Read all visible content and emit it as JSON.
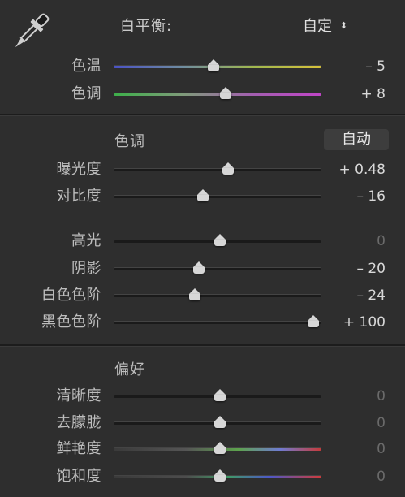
{
  "white_balance": {
    "label": "白平衡:",
    "value": "自定",
    "sliders": [
      {
        "name": "temp",
        "label": "色温",
        "value_text": "– 5",
        "position": 0.48,
        "track": "linear-gradient(90deg,#4a52c6,#6f8da0,#9fb74f,#d6c13a)",
        "dim": false
      },
      {
        "name": "tint",
        "label": "色调",
        "value_text": "+ 8",
        "position": 0.54,
        "track": "linear-gradient(90deg,#3db04a,#7f9b7a,#a35fb0,#c045c7)",
        "dim": false
      }
    ]
  },
  "tone": {
    "title": "色调",
    "auto_label": "自动",
    "sliders": [
      {
        "name": "exposure",
        "label": "曝光度",
        "value_text": "+ 0.48",
        "position": 0.55,
        "dim": false
      },
      {
        "name": "contrast",
        "label": "对比度",
        "value_text": "– 16",
        "position": 0.43,
        "dim": false
      },
      {
        "name": "highlights",
        "label": "高光",
        "value_text": "0",
        "position": 0.51,
        "dim": true
      },
      {
        "name": "shadows",
        "label": "阴影",
        "value_text": "– 20",
        "position": 0.41,
        "dim": false
      },
      {
        "name": "whites",
        "label": "白色色阶",
        "value_text": "– 24",
        "position": 0.39,
        "dim": false
      },
      {
        "name": "blacks",
        "label": "黑色色阶",
        "value_text": "+ 100",
        "position": 0.96,
        "dim": false
      }
    ]
  },
  "presence": {
    "title": "偏好",
    "sliders": [
      {
        "name": "clarity",
        "label": "清晰度",
        "value_text": "0",
        "position": 0.51,
        "dim": true
      },
      {
        "name": "dehaze",
        "label": "去朦胧",
        "value_text": "0",
        "position": 0.51,
        "dim": true
      },
      {
        "name": "vibrance",
        "label": "鲜艳度",
        "value_text": "0",
        "position": 0.51,
        "dim": true,
        "track": "linear-gradient(90deg,#3a3a3a,#555 35%,#5da24d 60%,#6f7bd1 80%,#c63a3a)"
      },
      {
        "name": "saturation",
        "label": "饱和度",
        "value_text": "0",
        "position": 0.51,
        "dim": true,
        "track": "linear-gradient(90deg,#3a3a3a,#4d4d4d 35%,#3f9a66 55%,#4d58c8 75%,#cf3b3b)"
      }
    ]
  },
  "colors": {
    "panel_bg": "#2e2e2e",
    "thumb": "#d7d7d7",
    "track_dark": "#1a1a1a"
  }
}
